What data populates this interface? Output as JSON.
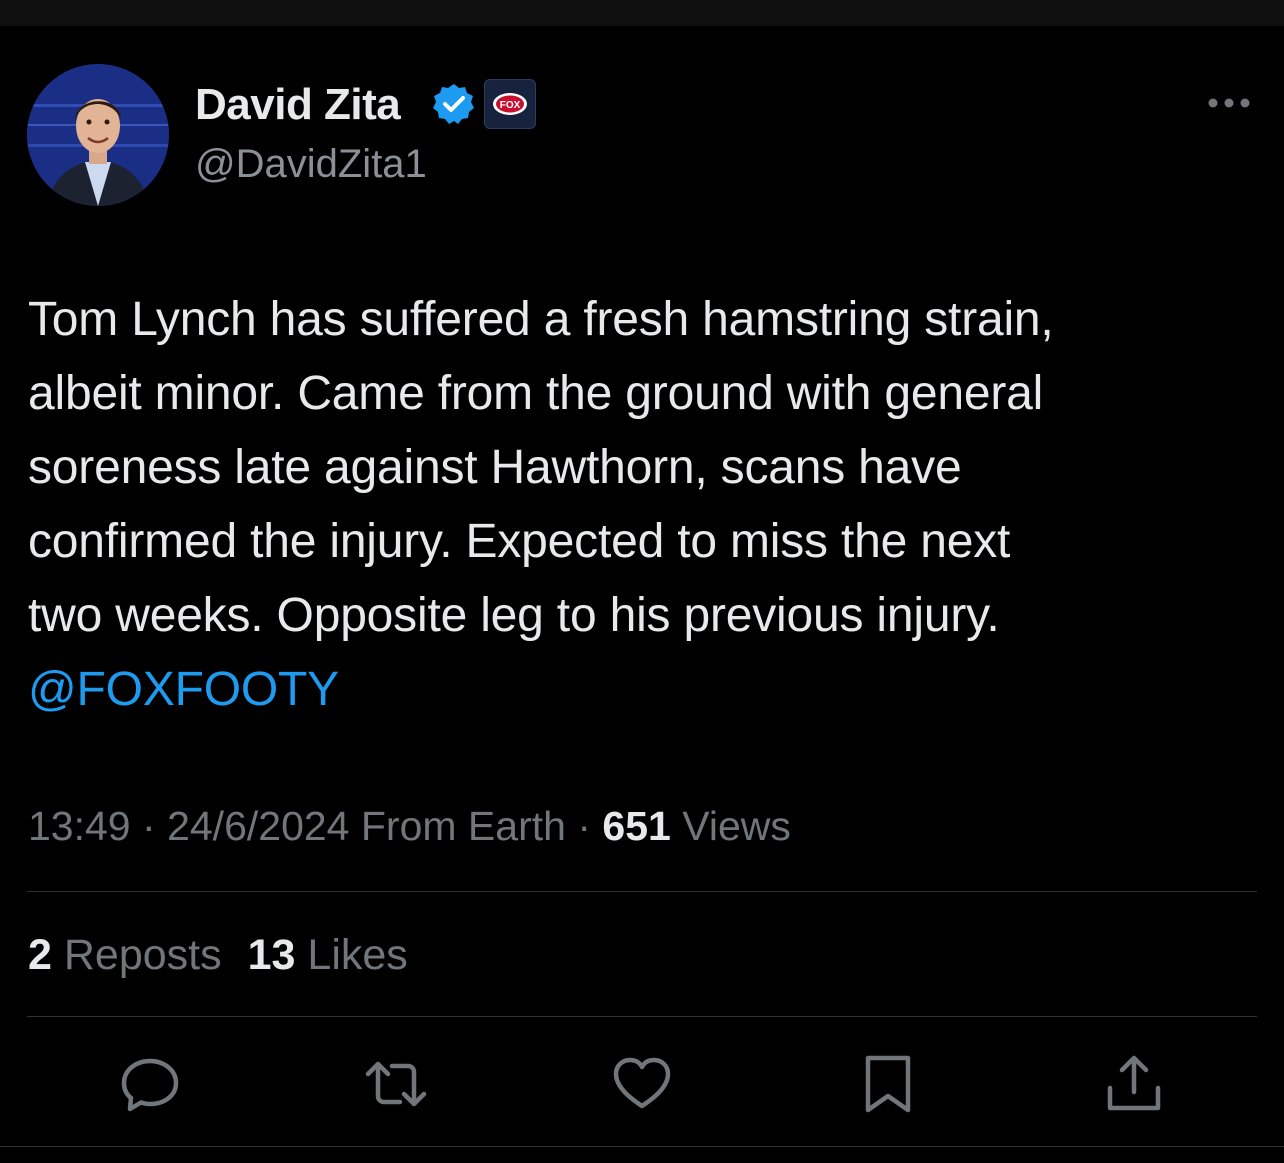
{
  "tweet": {
    "author": {
      "display_name": "David Zita",
      "handle": "@DavidZita1",
      "verified": true,
      "affiliate_badge_text": "FOX"
    },
    "text_lines": [
      "Tom Lynch has suffered a fresh hamstring strain,",
      "albeit minor. Came from the ground with general",
      "soreness late against Hawthorn, scans have",
      "confirmed the injury. Expected to miss the next",
      "two weeks. Opposite leg to his previous injury."
    ],
    "mention": "@FOXFOOTY",
    "time": "13:49",
    "date": "24/6/2024",
    "source": "From Earth",
    "views_count": "651",
    "views_label": "Views",
    "separator": "·",
    "reposts_count": "2",
    "reposts_label": "Reposts",
    "likes_count": "13",
    "likes_label": "Likes"
  },
  "actions": {
    "reply": "reply-icon",
    "repost": "repost-icon",
    "like": "heart-icon",
    "bookmark": "bookmark-icon",
    "share": "share-icon"
  },
  "colors": {
    "background": "#000000",
    "text": "#e7e9ea",
    "secondary": "#71767b",
    "accent": "#1d9bf0",
    "divider": "#2f3336"
  }
}
